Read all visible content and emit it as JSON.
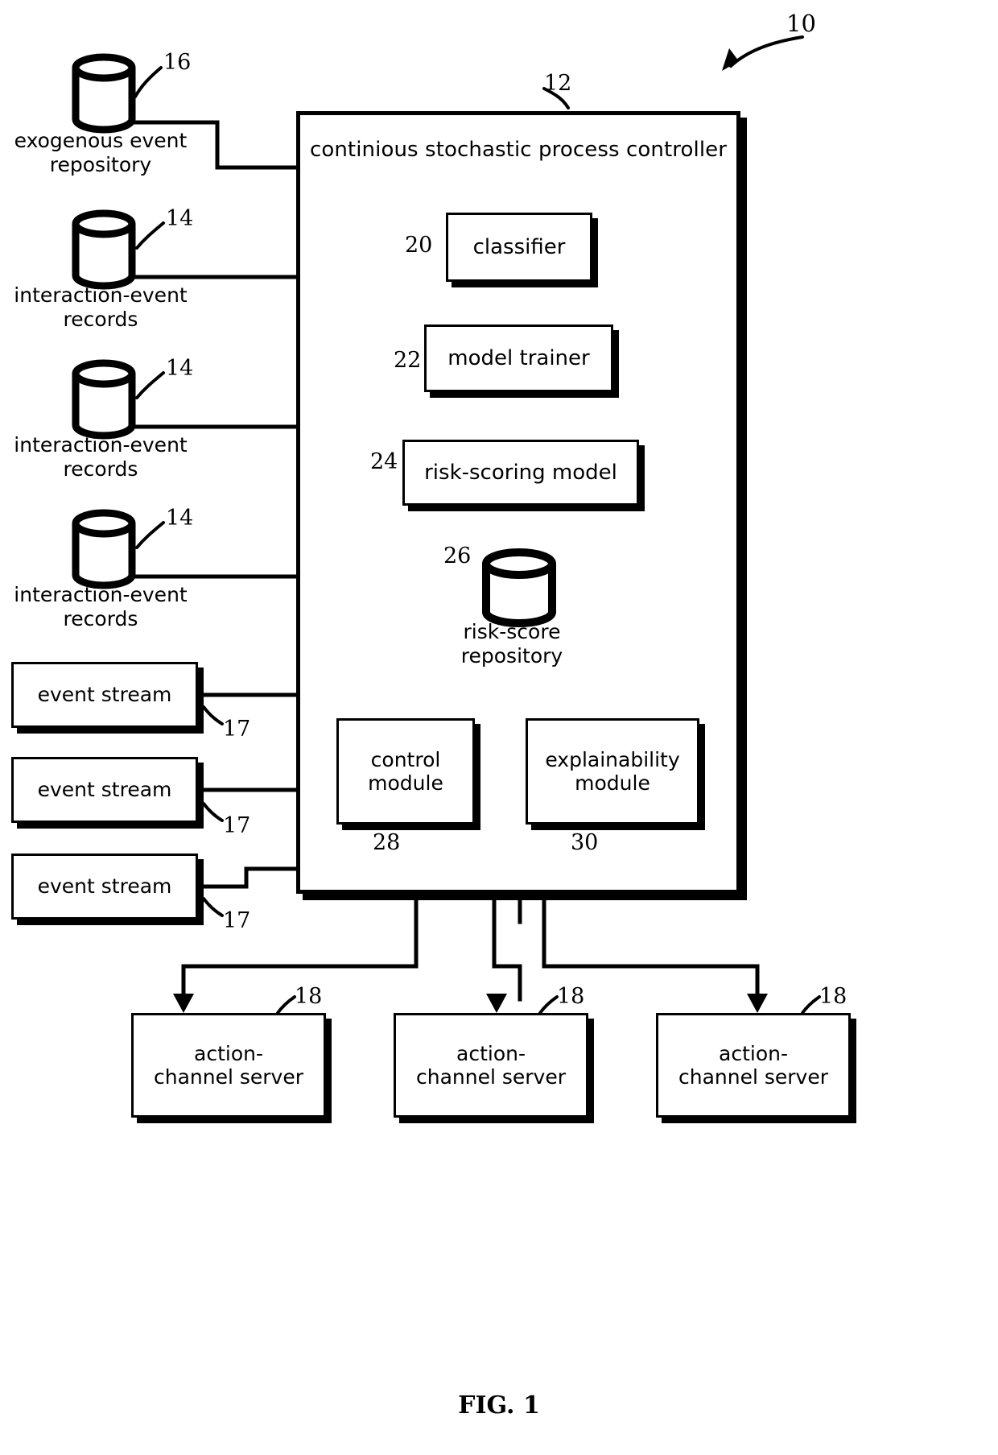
{
  "figure": {
    "caption": "FIG. 1",
    "system_ref": "10"
  },
  "controller": {
    "title": "continious stochastic process controller",
    "ref": "12",
    "modules": [
      {
        "id": "classifier",
        "label": "classifier",
        "ref": "20"
      },
      {
        "id": "model_trainer",
        "label": "model trainer",
        "ref": "22"
      },
      {
        "id": "risk_model",
        "label": "risk-scoring model",
        "ref": "24"
      },
      {
        "id": "control",
        "label": "control\nmodule",
        "line1": "control",
        "line2": "module",
        "ref": "28"
      },
      {
        "id": "explainability",
        "label": "explainability module",
        "line1": "explainability",
        "line2": "module",
        "ref": "30"
      }
    ],
    "internal_store": {
      "id": "risk_score_repository",
      "line1": "risk-score",
      "line2": "repository",
      "ref": "26"
    }
  },
  "data_sources": [
    {
      "id": "exogenous",
      "line1": "exogenous event",
      "line2": "repository",
      "ref": "16"
    },
    {
      "id": "interaction_a",
      "line1": "interaction-event",
      "line2": "records",
      "ref": "14"
    },
    {
      "id": "interaction_b",
      "line1": "interaction-event",
      "line2": "records",
      "ref": "14"
    },
    {
      "id": "interaction_c",
      "line1": "interaction-event",
      "line2": "records",
      "ref": "14"
    }
  ],
  "event_streams": [
    {
      "id": "event_stream_0",
      "label": "event stream",
      "ref": "17"
    },
    {
      "id": "event_stream_1",
      "label": "event stream",
      "ref": "17"
    },
    {
      "id": "event_stream_2",
      "label": "event stream",
      "ref": "17"
    }
  ],
  "action_channel_servers": [
    {
      "id": "server_0",
      "line1": "action-",
      "line2": "channel server",
      "ref": "18"
    },
    {
      "id": "server_1",
      "line1": "action-",
      "line2": "channel server",
      "ref": "18"
    },
    {
      "id": "server_2",
      "line1": "action-",
      "line2": "channel server",
      "ref": "18"
    }
  ],
  "colors": {
    "ink": "#000000",
    "paper": "#ffffff"
  }
}
